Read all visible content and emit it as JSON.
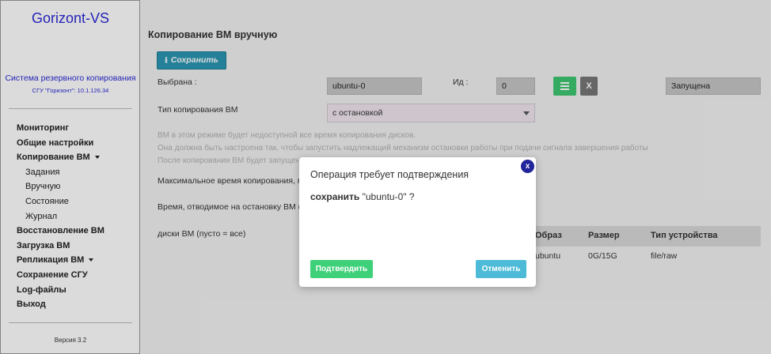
{
  "sidebar": {
    "brand": "Gorizont-VS",
    "subtitle": "Система резервного копирования",
    "server": "СГУ \"Горизонт\": 10.1.126.34",
    "items": [
      {
        "label": "Мониторинг"
      },
      {
        "label": "Общие настройки"
      },
      {
        "label": "Копирование ВМ"
      },
      {
        "label": "Задания"
      },
      {
        "label": "Вручную"
      },
      {
        "label": "Состояние"
      },
      {
        "label": "Журнал"
      },
      {
        "label": "Восстановление ВМ"
      },
      {
        "label": "Загрузка ВМ"
      },
      {
        "label": "Репликация ВМ"
      },
      {
        "label": "Сохранение СГУ"
      },
      {
        "label": "Log-файлы"
      },
      {
        "label": "Выход"
      }
    ],
    "version": "Версия 3.2"
  },
  "main": {
    "title": "Копирование ВМ вручную",
    "save_label": "Сохранить",
    "selected_label": "Выбрана :",
    "selected_value": "ubuntu-0",
    "id_label": "Ид :",
    "id_value": "0",
    "x_button": "X",
    "state_value": "Запущена",
    "copy_type_label": "Тип копирования ВМ",
    "copy_type_value": "с остановкой",
    "info_lines": [
      "ВМ в этом режиме будет недоступной все время копирования дисков.",
      "Она должна быть настроена так, чтобы запустить надлежащий механизм остановки работы при подачи сигнала завершения работы",
      "После копирования ВМ будет запущена"
    ],
    "max_time_label": "Максимальное время копирования, мин",
    "stop_time_label": "Время, отводимое на остановку ВМ (сек",
    "disks_label": "диски ВМ (пусто = все)",
    "table": {
      "headers": [
        "Образ",
        "Размер",
        "Тип устройства"
      ],
      "rows": [
        [
          "ubuntu",
          "0G/15G",
          "file/raw"
        ]
      ]
    }
  },
  "modal": {
    "title": "Операция требует подтверждения",
    "prefix": "сохранить ",
    "target": "\"ubuntu-0\" ?",
    "close": "x",
    "confirm": "Подтвердить",
    "cancel": "Отменить"
  },
  "colors": {
    "brand": "#2a2ad6",
    "save_button": "#2b97b3",
    "list_button": "#3ec773",
    "confirm_button": "#3fd07a",
    "cancel_button": "#4dbbd8",
    "close_badge": "#22249a"
  },
  "icons": {
    "save": "download-icon",
    "list": "list-icon",
    "close": "close-icon",
    "caret": "caret-down-icon"
  }
}
